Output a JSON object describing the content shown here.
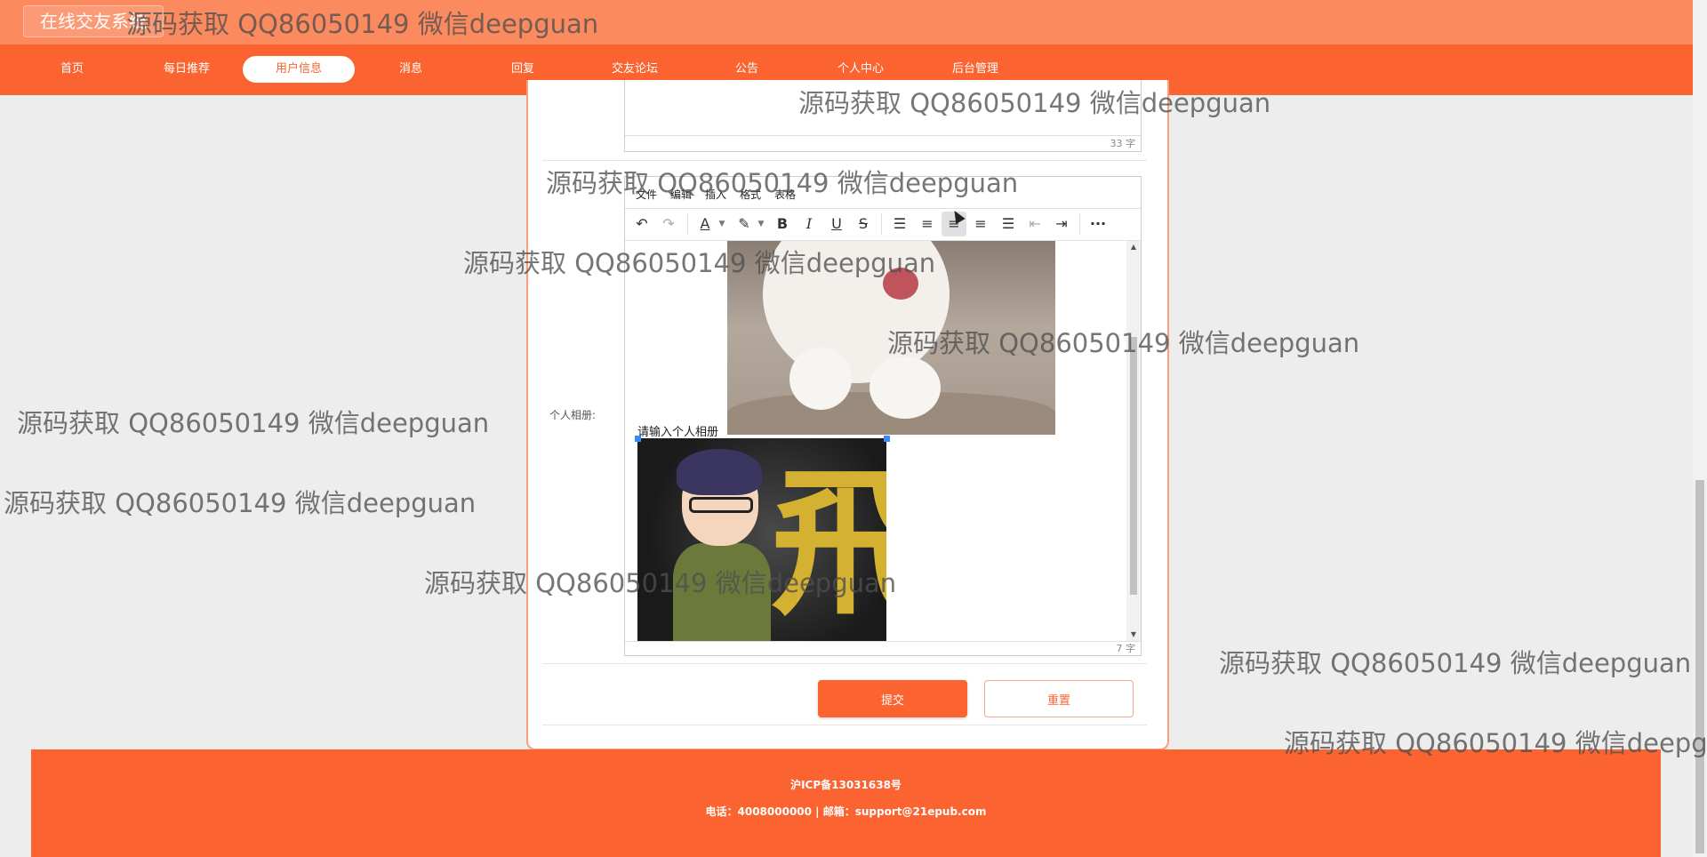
{
  "header": {
    "site_title": "在线交友系统"
  },
  "nav": {
    "items": [
      "首页",
      "每日推荐",
      "用户信息",
      "消息",
      "回复",
      "交友论坛",
      "公告",
      "个人中心",
      "后台管理"
    ],
    "active_index": 2
  },
  "prev_editor": {
    "char_count": "33 字"
  },
  "form": {
    "album_label": "个人相册:"
  },
  "editor": {
    "menu": [
      "文件",
      "编辑",
      "插入",
      "格式",
      "表格"
    ],
    "toolbar_icons": [
      "undo-icon",
      "redo-icon",
      "text-color-icon",
      "highlight-icon",
      "bold-icon",
      "italic-icon",
      "underline-icon",
      "strikethrough-icon",
      "list-icon",
      "align-left-icon",
      "align-center-icon",
      "align-right-icon",
      "align-justify-icon",
      "outdent-icon",
      "indent-icon",
      "more-icon"
    ],
    "placeholder_text": "请输入个人相册",
    "char_count": "7 字"
  },
  "buttons": {
    "submit": "提交",
    "reset": "重置"
  },
  "footer": {
    "icp": "沪ICP备13031638号",
    "contact": "电话：4008000000 | 邮箱：support@21epub.com"
  },
  "watermark": "源码获取 QQ86050149 微信deepguan",
  "colors": {
    "primary": "#fb6430",
    "header": "#fb8a5f",
    "background": "#ededed"
  }
}
